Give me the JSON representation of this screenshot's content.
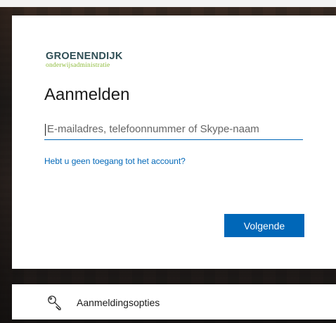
{
  "brand": {
    "name": "GROENENDIJK",
    "tagline": "onderwijsadministratie",
    "colors": {
      "primary": "#2f4e55",
      "accent": "#8dbb3a"
    }
  },
  "signin": {
    "title": "Aanmelden",
    "email_placeholder": "E-mailadres, telefoonnummer of Skype-naam",
    "email_value": "",
    "help_link": "Hebt u geen toegang tot het account?",
    "next_button": "Volgende"
  },
  "options": {
    "label": "Aanmeldingsopties",
    "icon": "key-icon"
  },
  "theme": {
    "button_blue": "#0067b8",
    "link_blue": "#0067b8"
  }
}
